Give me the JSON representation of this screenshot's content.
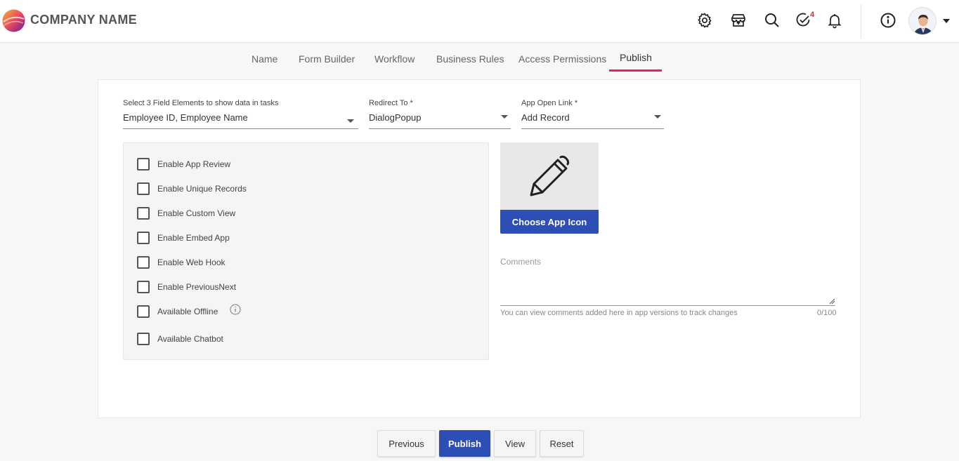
{
  "header": {
    "company_name": "COMPANY NAME",
    "task_badge": "4",
    "icons": [
      "settings-icon",
      "app-store-icon",
      "search-icon",
      "tasks-check-icon",
      "bell-icon",
      "info-icon"
    ]
  },
  "tabs": [
    {
      "label": "Name"
    },
    {
      "label": "Form Builder"
    },
    {
      "label": "Workflow"
    },
    {
      "label": "Business Rules"
    },
    {
      "label": "Access Permissions"
    },
    {
      "label": "Publish",
      "active": true
    }
  ],
  "fields": {
    "task_fields": {
      "label": "Select 3 Field Elements to show data in tasks",
      "value": "Employee ID, Employee Name"
    },
    "redirect_to": {
      "label": "Redirect To *",
      "value": "DialogPopup"
    },
    "app_open_link": {
      "label": "App Open Link *",
      "value": "Add Record"
    }
  },
  "checkboxes": [
    {
      "label": "Enable App Review",
      "checked": false
    },
    {
      "label": "Enable Unique Records",
      "checked": false
    },
    {
      "label": "Enable Custom View",
      "checked": false
    },
    {
      "label": "Enable Embed App",
      "checked": false
    },
    {
      "label": "Enable Web Hook",
      "checked": false
    },
    {
      "label": "Enable PreviousNext",
      "checked": false
    },
    {
      "label": "Available Offline",
      "checked": false
    },
    {
      "label": "Available Chatbot",
      "checked": false
    }
  ],
  "app_icon": {
    "button_label": "Choose App Icon",
    "icon": "pen-icon"
  },
  "comments": {
    "label": "Comments",
    "value": "",
    "help": "You can view comments added here in app versions to track changes",
    "count": "0/100"
  },
  "footer": {
    "previous": "Previous",
    "publish": "Publish",
    "view": "View",
    "reset": "Reset"
  },
  "colors": {
    "primary": "#2d4fb5",
    "tab_underline": "#e91e63",
    "badge": "#d32f2f"
  }
}
